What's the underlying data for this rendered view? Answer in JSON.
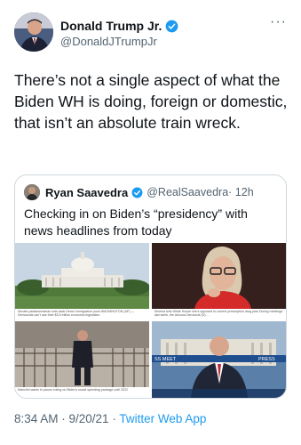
{
  "author": {
    "display_name": "Donald Trump Jr.",
    "handle": "@DonaldJTrumpJr",
    "verified_icon": "verified-badge-icon"
  },
  "more_icon": "more-options-icon",
  "tweet": {
    "text": "There’s not a single aspect of what the Biden WH is doing, foreign or domestic, that isn’t an absolute train wreck."
  },
  "quoted": {
    "display_name": "Ryan Saavedra",
    "handle": "@RealSaavedra",
    "time": "· 12h",
    "text": "Checking in on Biden’s “presidency” with news headlines from today",
    "images": [
      {
        "caption": "Senate parliamentarian sets back Dems' immigration push WASHINGTON (AP) — Democrats can't use their $3.5 trillion economic legislation",
        "icon": "capitol-photo"
      },
      {
        "caption": "Sinema tells White House she's opposed to current prescription drug plan During meetings last week, the Arizona Democrat (D) ...",
        "icon": "senator-photo"
      },
      {
        "caption": "Manchin wants to pause voting on Biden's social spending package until 2022",
        "icon": "stairs-photo"
      },
      {
        "caption": "",
        "icon": "tv-news-photo"
      }
    ]
  },
  "footer": {
    "time": "8:34 AM · 9/20/21 · ",
    "app": "Twitter Web App"
  },
  "colors": {
    "accent": "#1d9bf0",
    "muted": "#536471",
    "border": "#cfd9de"
  }
}
